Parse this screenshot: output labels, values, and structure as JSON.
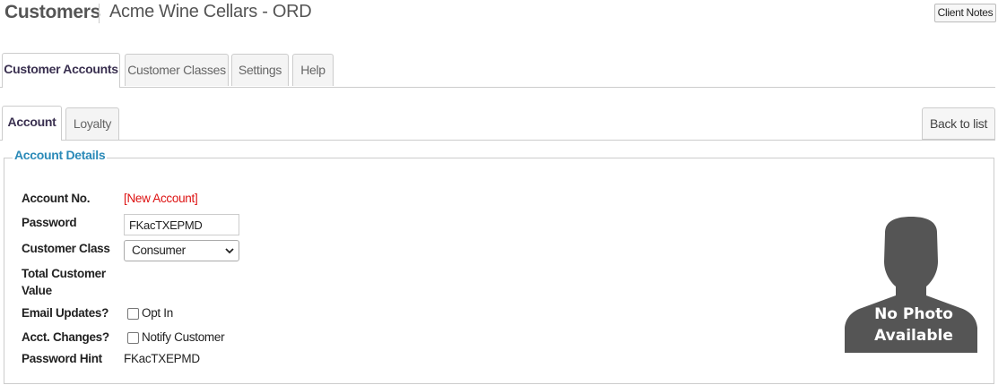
{
  "header": {
    "title": "Customers",
    "client": "Acme Wine Cellars - ORD",
    "client_notes_label": "Client Notes"
  },
  "tabs": [
    {
      "label": "Customer Accounts",
      "active": true
    },
    {
      "label": "Customer Classes",
      "active": false
    },
    {
      "label": "Settings",
      "active": false
    },
    {
      "label": "Help",
      "active": false
    }
  ],
  "subtabs": [
    {
      "label": "Account",
      "active": true
    },
    {
      "label": "Loyalty",
      "active": false
    }
  ],
  "back_to_list_label": "Back to list",
  "account_details": {
    "legend": "Account Details",
    "account_no_label": "Account No.",
    "account_no_value": "[New Account]",
    "password_label": "Password",
    "password_value": "FKacTXEPMD",
    "customer_class_label": "Customer Class",
    "customer_class_value": "Consumer",
    "total_value_label": "Total Customer Value",
    "email_updates_label": "Email Updates?",
    "opt_in_label": "Opt In",
    "opt_in_checked": false,
    "acct_changes_label": "Acct. Changes?",
    "notify_label": "Notify Customer",
    "notify_checked": false,
    "password_hint_label": "Password Hint",
    "password_hint_value": "FKacTXEPMD"
  },
  "photo": {
    "line1": "No Photo",
    "line2": "Available",
    "color": "#555555"
  }
}
